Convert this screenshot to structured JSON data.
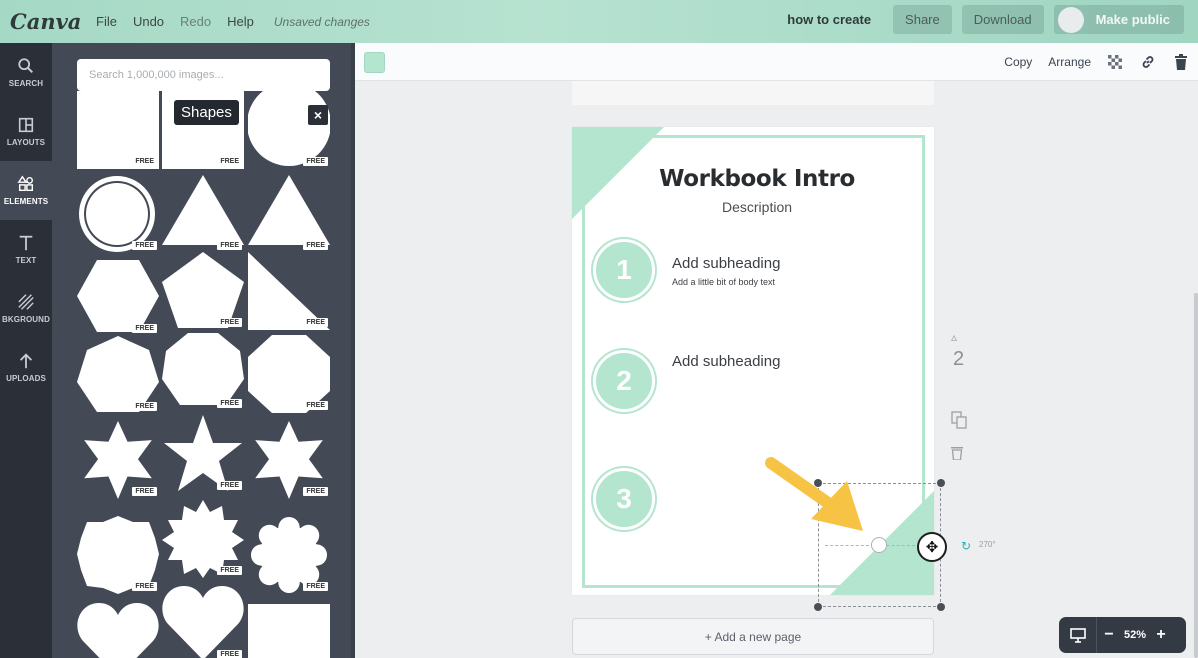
{
  "topbar": {
    "logo": "Canva",
    "menu": [
      {
        "label": "File"
      },
      {
        "label": "Undo"
      },
      {
        "label": "Redo"
      },
      {
        "label": "Help"
      }
    ],
    "status": "Unsaved changes",
    "doc_title": "how to create",
    "share_label": "Share",
    "download_label": "Download",
    "make_public_label": "Make public"
  },
  "rail": {
    "items": [
      {
        "label": "SEARCH",
        "icon": "search-icon"
      },
      {
        "label": "LAYOUTS",
        "icon": "layouts-icon"
      },
      {
        "label": "ELEMENTS",
        "icon": "elements-icon"
      },
      {
        "label": "TEXT",
        "icon": "text-icon"
      },
      {
        "label": "BKGROUND",
        "icon": "background-icon"
      },
      {
        "label": "UPLOADS",
        "icon": "uploads-icon"
      }
    ],
    "active": "ELEMENTS"
  },
  "panel": {
    "search_placeholder": "Search 1,000,000 images...",
    "tooltip": "Shapes",
    "close": "×",
    "free_badge": "FREE"
  },
  "toolbar": {
    "copy_label": "Copy",
    "arrange_label": "Arrange",
    "accent_color": "#b4e5cf"
  },
  "page": {
    "title": "Workbook Intro",
    "description": "Description",
    "steps": [
      {
        "number": "1",
        "subheading": "Add subheading",
        "body": "Add a little bit of body text"
      },
      {
        "number": "2",
        "subheading": "Add subheading",
        "body": ""
      },
      {
        "number": "3",
        "subheading": "",
        "body": ""
      }
    ],
    "page_number": "2",
    "rotation": "270°"
  },
  "add_page_label": "+ Add a new page",
  "zoom": {
    "minus": "−",
    "value": "52%",
    "plus": "+"
  }
}
